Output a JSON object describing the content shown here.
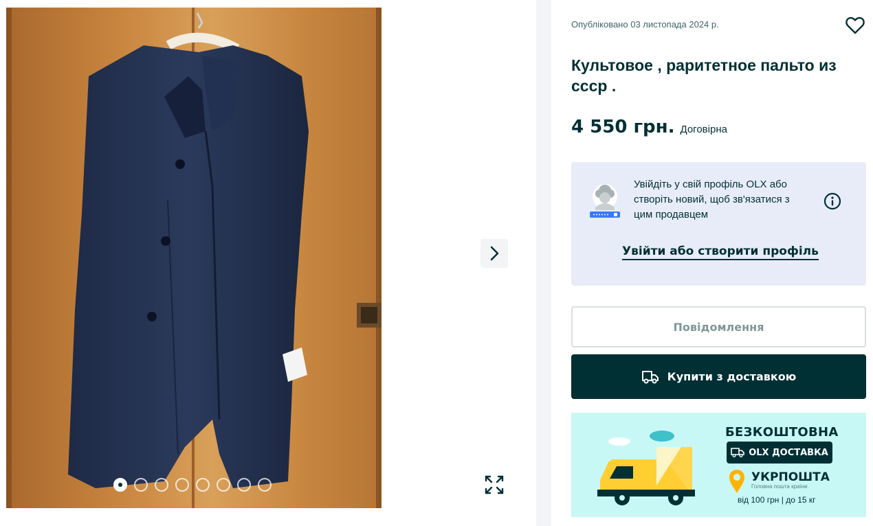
{
  "gallery": {
    "photo_count": 8,
    "active_index": 0,
    "next_label": "next-image",
    "fullscreen_label": "fullscreen"
  },
  "listing": {
    "posted": "Опубліковано 03 листопада 2024 р.",
    "title": "Культовое , раритетное пальто из ссср .",
    "price": "4 550 грн.",
    "negotiable": "Договірна"
  },
  "login_prompt": {
    "text": "Увійдіть у свій профіль OLX або створіть новий, щоб зв'язатися з цим продавцем",
    "link": "Увійти або створити профіль"
  },
  "actions": {
    "message": "Повідомлення",
    "buy_delivery": "Купити з доставкою"
  },
  "promo": {
    "free": "БЕЗКОШТОВНА",
    "badge": "OLX ДОСТАВКА",
    "carrier": "УКРПОШТА",
    "carrier_sub": "Головна пошта країни",
    "terms": "від 100 грн | до 15 кг"
  },
  "colors": {
    "brand_dark": "#002f34",
    "login_bg": "#e8ecf9",
    "promo_bg": "#c8f8f6",
    "truck_yellow": "#ffce32"
  }
}
